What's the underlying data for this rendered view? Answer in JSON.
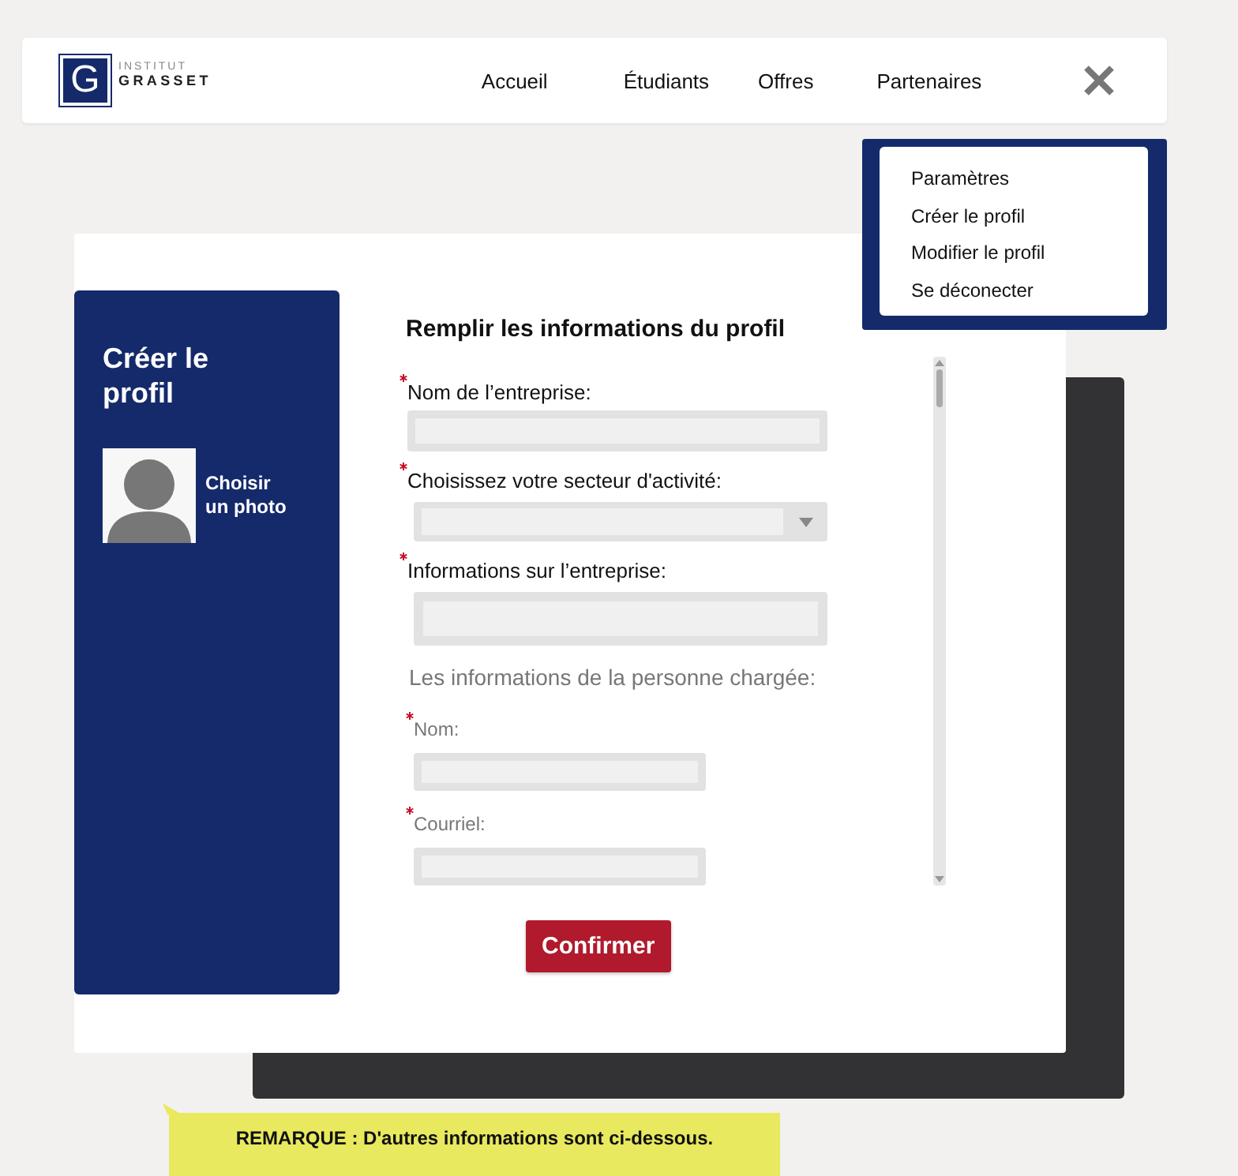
{
  "header": {
    "logo": {
      "line1": "INSTITUT",
      "line2": "GRASSET",
      "letter": "G"
    },
    "nav": [
      {
        "label": "Accueil"
      },
      {
        "label": "Étudiants"
      },
      {
        "label": "Offres"
      },
      {
        "label": "Partenaires"
      }
    ]
  },
  "menu": {
    "items": [
      {
        "label": "Paramètres"
      },
      {
        "label": "Créer le profil"
      },
      {
        "label": "Modifier le profil"
      },
      {
        "label": "Se déconecter"
      }
    ]
  },
  "sidebar": {
    "title": "Créer le profil",
    "photo_button": "Choisir un photo"
  },
  "form": {
    "title": "Remplir les informations du profil",
    "fields": [
      {
        "kind": "text",
        "label": "Nom de l’entreprise:",
        "required": true
      },
      {
        "kind": "select",
        "label": "Choisissez votre secteur d'activité:",
        "required": true
      },
      {
        "kind": "textarea",
        "label": "Informations sur l’entreprise:",
        "required": true
      }
    ],
    "section": "Les informations de la personne chargée:",
    "contact_fields": [
      {
        "kind": "text",
        "label": "Nom:",
        "required": true
      },
      {
        "kind": "text",
        "label": "Courriel:",
        "required": true
      }
    ],
    "confirm_button": "Confirmer"
  },
  "note": "REMARQUE : D'autres informations sont ci-dessous."
}
